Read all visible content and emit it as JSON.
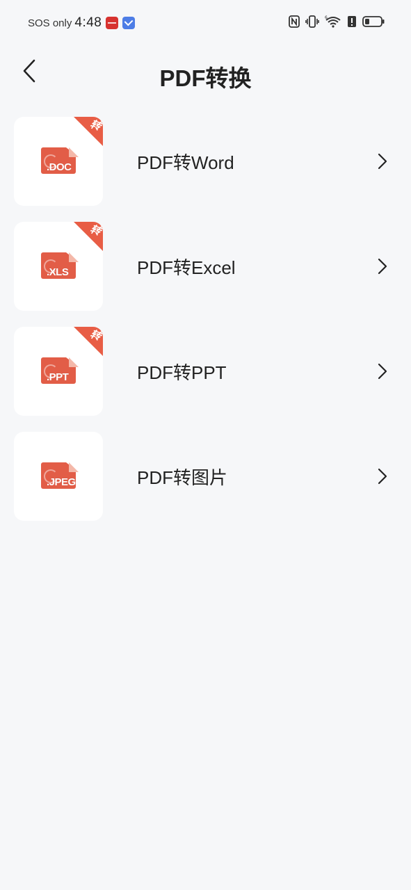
{
  "status_bar": {
    "carrier": "SOS only",
    "time": "4:48"
  },
  "header": {
    "title": "PDF转换"
  },
  "conversions": [
    {
      "label": "PDF转Word",
      "file_ext": ".DOC",
      "badge": "转"
    },
    {
      "label": "PDF转Excel",
      "file_ext": ".XLS",
      "badge": "转"
    },
    {
      "label": "PDF转PPT",
      "file_ext": ".PPT",
      "badge": "转"
    },
    {
      "label": "PDF转图片",
      "file_ext": ".JPEG",
      "badge": ""
    }
  ],
  "colors": {
    "accent": "#e85d45",
    "background": "#f6f7f9",
    "card": "#ffffff",
    "text": "#222222"
  },
  "icons": {
    "back": "chevron-left-icon",
    "row_arrow": "chevron-right-icon",
    "nfc": "nfc-icon",
    "vibrate": "vibrate-icon",
    "wifi": "wifi-icon",
    "battery": "battery-icon"
  }
}
